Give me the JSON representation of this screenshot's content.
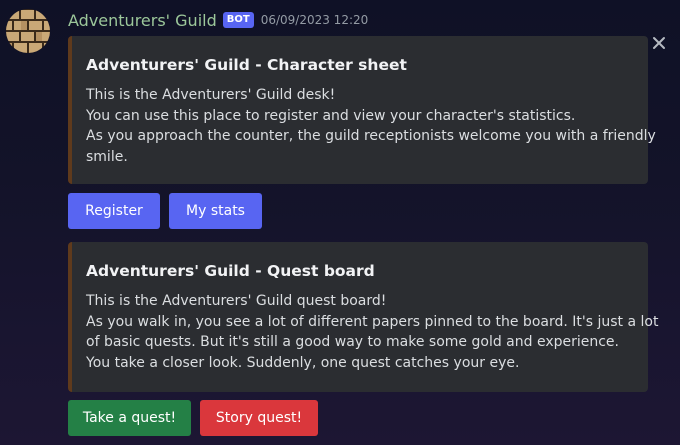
{
  "message": {
    "author": "Adventurers' Guild",
    "bot_tag": "BOT",
    "timestamp": "06/09/2023 12:20"
  },
  "icons": {
    "avatar": "brick-wall-avatar",
    "close": "close-icon"
  },
  "colors": {
    "username": "#9cc79a",
    "embed_accent": "#5f3a1c",
    "embed_bg": "#2b2d31",
    "primary_button": "#5865f2",
    "success_button": "#248046",
    "danger_button": "#da373c"
  },
  "embeds": [
    {
      "title": "Adventurers' Guild - Character sheet",
      "lines": [
        "This is the Adventurers' Guild desk!",
        "You can use this place to register and view your character's statistics.",
        "As you approach the counter, the guild receptionists welcome you with a friendly",
        "smile."
      ],
      "buttons": [
        {
          "label": "Register"
        },
        {
          "label": "My stats"
        }
      ]
    },
    {
      "title": "Adventurers' Guild - Quest board",
      "lines": [
        "This is the Adventurers' Guild quest board!",
        "As you walk in, you see a lot of different papers pinned to the board. It's just a lot",
        "of basic quests. But it's still a good way to make some gold and experience.",
        "You take a closer look. Suddenly, one quest catches your eye."
      ],
      "buttons": [
        {
          "label": "Take a quest!"
        },
        {
          "label": "Story quest!"
        }
      ]
    }
  ]
}
